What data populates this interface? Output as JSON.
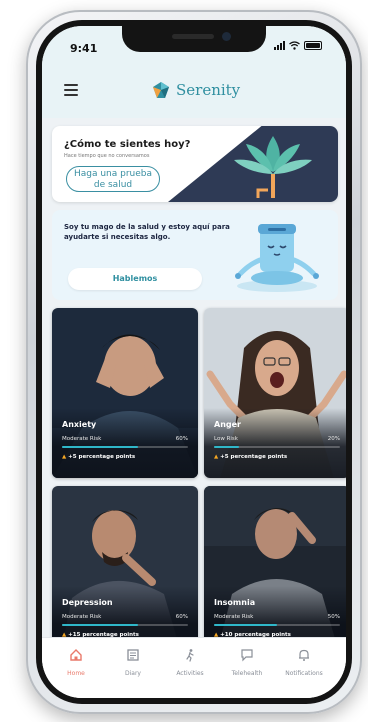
{
  "status": {
    "time": "9:41"
  },
  "header": {
    "brand": "Serenity"
  },
  "mood_card": {
    "title": "¿Cómo te sientes hoy?",
    "subtitle": "Hace tiempo que no conversamos",
    "button": "Haga una prueba de salud"
  },
  "wizard_card": {
    "text": "Soy tu mago de la salud y estoy aquí para ayudarte si necesitas algo.",
    "button": "Hablemos"
  },
  "colors": {
    "accent": "#2f8fa0",
    "tab_active": "#e9796a",
    "bar": "#2fb7c9",
    "up_arrow": "#f5a623"
  },
  "tiles": [
    {
      "name": "Anxiety",
      "risk": "Moderate Risk",
      "percent": "60%",
      "progress": 0.6,
      "change": "+5 percentage points"
    },
    {
      "name": "Anger",
      "risk": "Low Risk",
      "percent": "20%",
      "progress": 0.2,
      "change": "+5 percentage points"
    },
    {
      "name": "Depression",
      "risk": "Moderate Risk",
      "percent": "60%",
      "progress": 0.6,
      "change": "+15 percentage points"
    },
    {
      "name": "Insomnia",
      "risk": "Moderate Risk",
      "percent": "50%",
      "progress": 0.5,
      "change": "+10 percentage points"
    }
  ],
  "tabs": [
    {
      "label": "Home",
      "icon": "home-icon",
      "active": true
    },
    {
      "label": "Diary",
      "icon": "diary-icon",
      "active": false
    },
    {
      "label": "Activities",
      "icon": "activities-icon",
      "active": false
    },
    {
      "label": "Telehealth",
      "icon": "telehealth-icon",
      "active": false
    },
    {
      "label": "Notifications",
      "icon": "notifications-icon",
      "active": false
    }
  ]
}
